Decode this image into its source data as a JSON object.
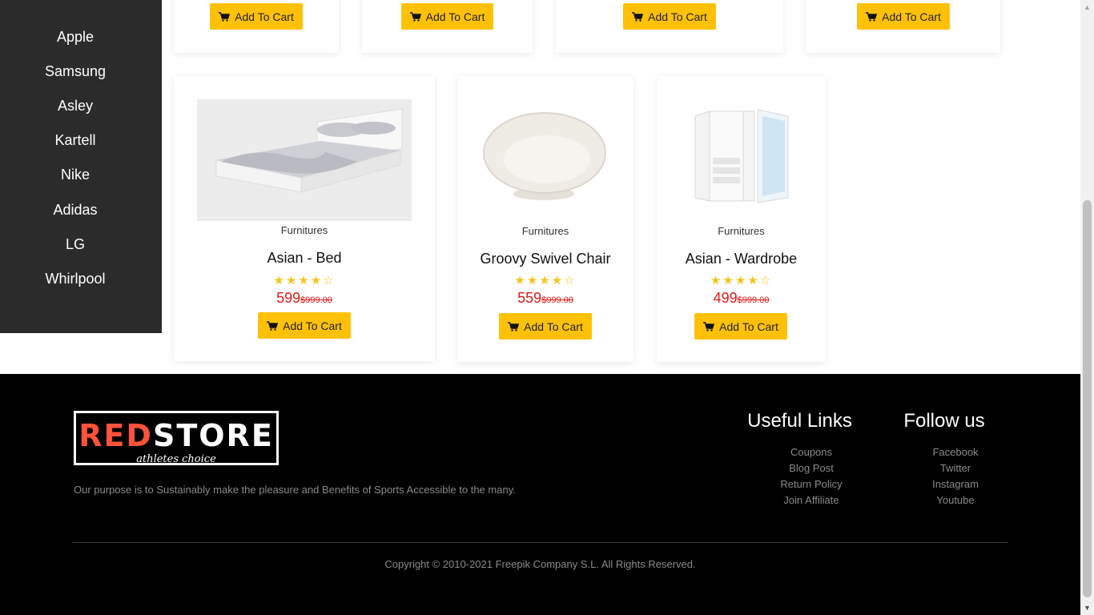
{
  "sidebar": {
    "brands": [
      "Apple",
      "Samsung",
      "Asley",
      "Kartell",
      "Nike",
      "Adidas",
      "LG",
      "Whirlpool"
    ]
  },
  "top_row": {
    "buttons": [
      "Add To Cart",
      "Add To Cart",
      "Add To Cart",
      "Add To Cart"
    ]
  },
  "products": [
    {
      "category": "Furnitures",
      "name": "Asian - Bed",
      "price": "599",
      "old_price": "$999.00",
      "rating": 4,
      "button": "Add To Cart"
    },
    {
      "category": "Furnitures",
      "name": "Groovy Swivel Chair",
      "price": "559",
      "old_price": "$999.00",
      "rating": 4,
      "button": "Add To Cart"
    },
    {
      "category": "Furnitures",
      "name": "Asian - Wardrobe",
      "price": "499",
      "old_price": "$999.00",
      "rating": 4,
      "button": "Add To Cart"
    }
  ],
  "footer": {
    "logo_red": "RED",
    "logo_white": "STORE",
    "logo_tagline": "athletes choice",
    "purpose": "Our purpose is to Sustainably make the pleasure and Benefits of Sports Accessible to the many.",
    "useful_title": "Useful Links",
    "useful_links": [
      "Coupons",
      "Blog Post",
      "Return Policy",
      "Join Affiliate"
    ],
    "follow_title": "Follow us",
    "follow_links": [
      "Facebook",
      "Twitter",
      "Instagram",
      "Youtube"
    ],
    "copyright": "Copyright © 2010-2021 Freepik Company S.L. All Rights Reserved."
  },
  "colors": {
    "accent": "#ffc107",
    "price": "#e01818",
    "brand_red": "#ff523b",
    "sidebar_bg": "#2b2b2b",
    "footer_bg": "#000000"
  },
  "icons": {
    "cart": "shopping-cart-icon",
    "star_full": "star-icon",
    "star_empty": "star-outline-icon"
  }
}
